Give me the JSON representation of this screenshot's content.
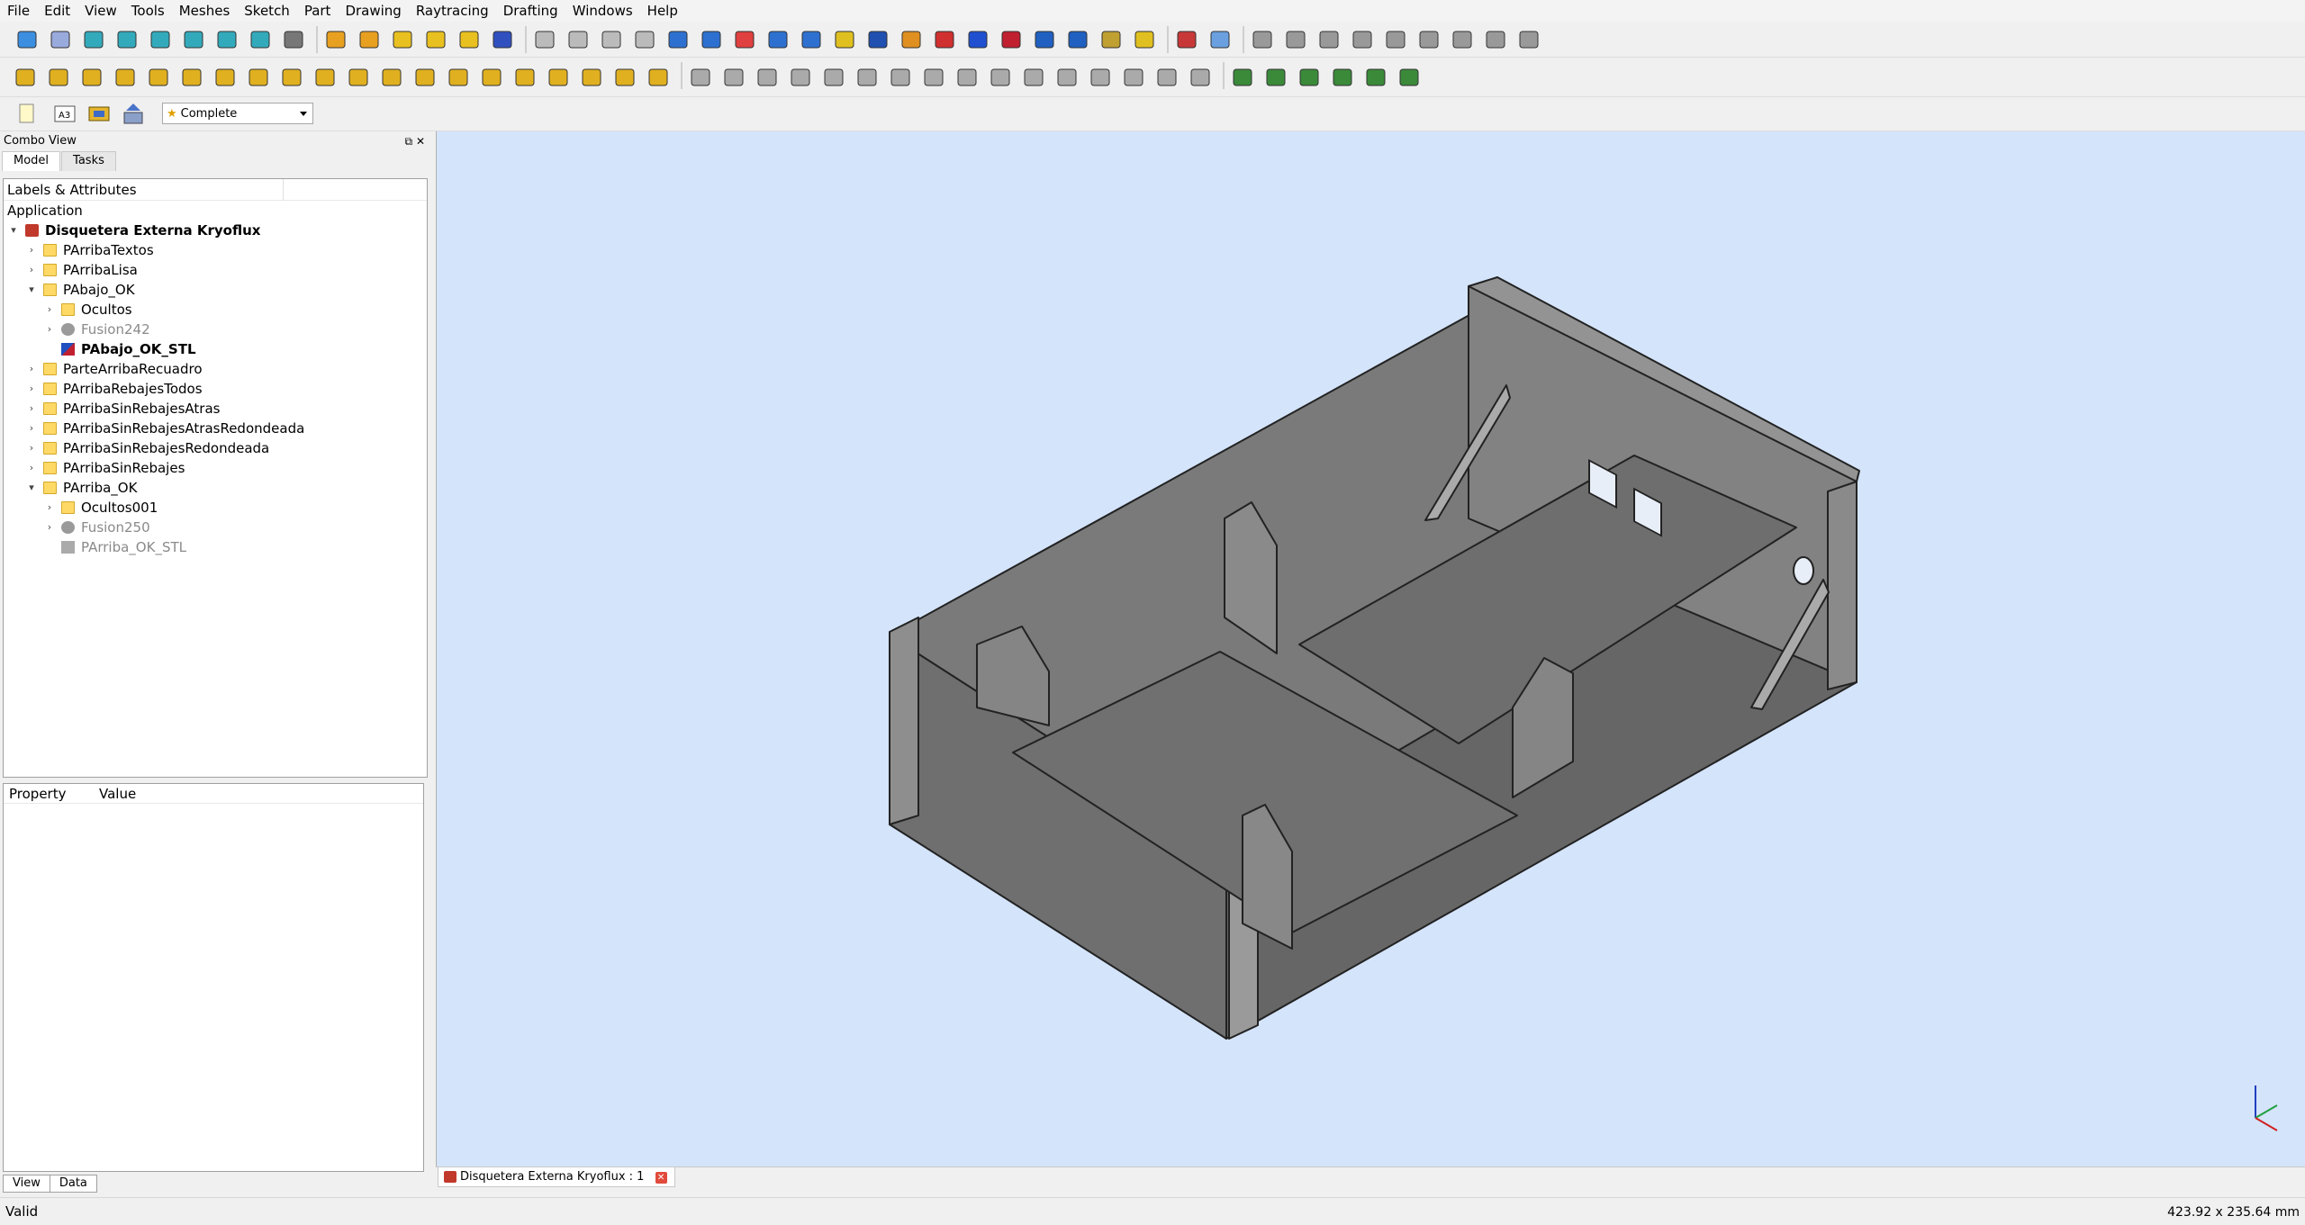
{
  "menu": [
    "File",
    "Edit",
    "View",
    "Tools",
    "Meshes",
    "Sketch",
    "Part",
    "Drawing",
    "Raytracing",
    "Drafting",
    "Windows",
    "Help"
  ],
  "workbench": {
    "selected": "Complete"
  },
  "combo": {
    "title": "Combo View",
    "tabs": [
      "Model",
      "Tasks"
    ],
    "tree_header": "Labels & Attributes",
    "application_label": "Application",
    "tree": [
      {
        "label": "Disquetera Externa Kryoflux",
        "level": 0,
        "expander": "open",
        "icon": "document-icon",
        "style": "bold"
      },
      {
        "label": "PArribaTextos",
        "level": 1,
        "expander": "closed",
        "icon": "folder-icon",
        "style": "normal"
      },
      {
        "label": "PArribaLisa",
        "level": 1,
        "expander": "closed",
        "icon": "folder-icon",
        "style": "normal"
      },
      {
        "label": "PAbajo_OK",
        "level": 1,
        "expander": "open",
        "icon": "folder-icon",
        "style": "normal"
      },
      {
        "label": "Ocultos",
        "level": 2,
        "expander": "closed",
        "icon": "folder-icon",
        "style": "normal"
      },
      {
        "label": "Fusion242",
        "level": 2,
        "expander": "closed",
        "icon": "fusion-icon",
        "style": "grey"
      },
      {
        "label": "PAbajo_OK_STL",
        "level": 2,
        "expander": "none",
        "icon": "mesh-icon",
        "style": "bold"
      },
      {
        "label": "ParteArribaRecuadro",
        "level": 1,
        "expander": "closed",
        "icon": "folder-icon",
        "style": "normal"
      },
      {
        "label": "PArribaRebajesTodos",
        "level": 1,
        "expander": "closed",
        "icon": "folder-icon",
        "style": "normal"
      },
      {
        "label": "PArribaSinRebajesAtras",
        "level": 1,
        "expander": "closed",
        "icon": "folder-icon",
        "style": "normal"
      },
      {
        "label": "PArribaSinRebajesAtrasRedondeada",
        "level": 1,
        "expander": "closed",
        "icon": "folder-icon",
        "style": "normal"
      },
      {
        "label": "PArribaSinRebajesRedondeada",
        "level": 1,
        "expander": "closed",
        "icon": "folder-icon",
        "style": "normal"
      },
      {
        "label": "PArribaSinRebajes",
        "level": 1,
        "expander": "closed",
        "icon": "folder-icon",
        "style": "normal"
      },
      {
        "label": "PArriba_OK",
        "level": 1,
        "expander": "open",
        "icon": "folder-icon",
        "style": "normal"
      },
      {
        "label": "Ocultos001",
        "level": 2,
        "expander": "closed",
        "icon": "folder-icon",
        "style": "normal"
      },
      {
        "label": "Fusion250",
        "level": 2,
        "expander": "closed",
        "icon": "fusion-icon",
        "style": "grey"
      },
      {
        "label": "PArriba_OK_STL",
        "level": 2,
        "expander": "none",
        "icon": "shape-icon",
        "style": "grey"
      }
    ],
    "property_headers": [
      "Property",
      "Value"
    ],
    "bottom_tabs": [
      "View",
      "Data"
    ]
  },
  "document_tab": {
    "label": "Disquetera Externa Kryoflux : 1"
  },
  "status": {
    "left": "Valid",
    "right": "423.92 x 235.64 mm"
  },
  "colors": {
    "viewport_bg": "#d4e4fb",
    "model_gray": "#7a7a7a"
  }
}
